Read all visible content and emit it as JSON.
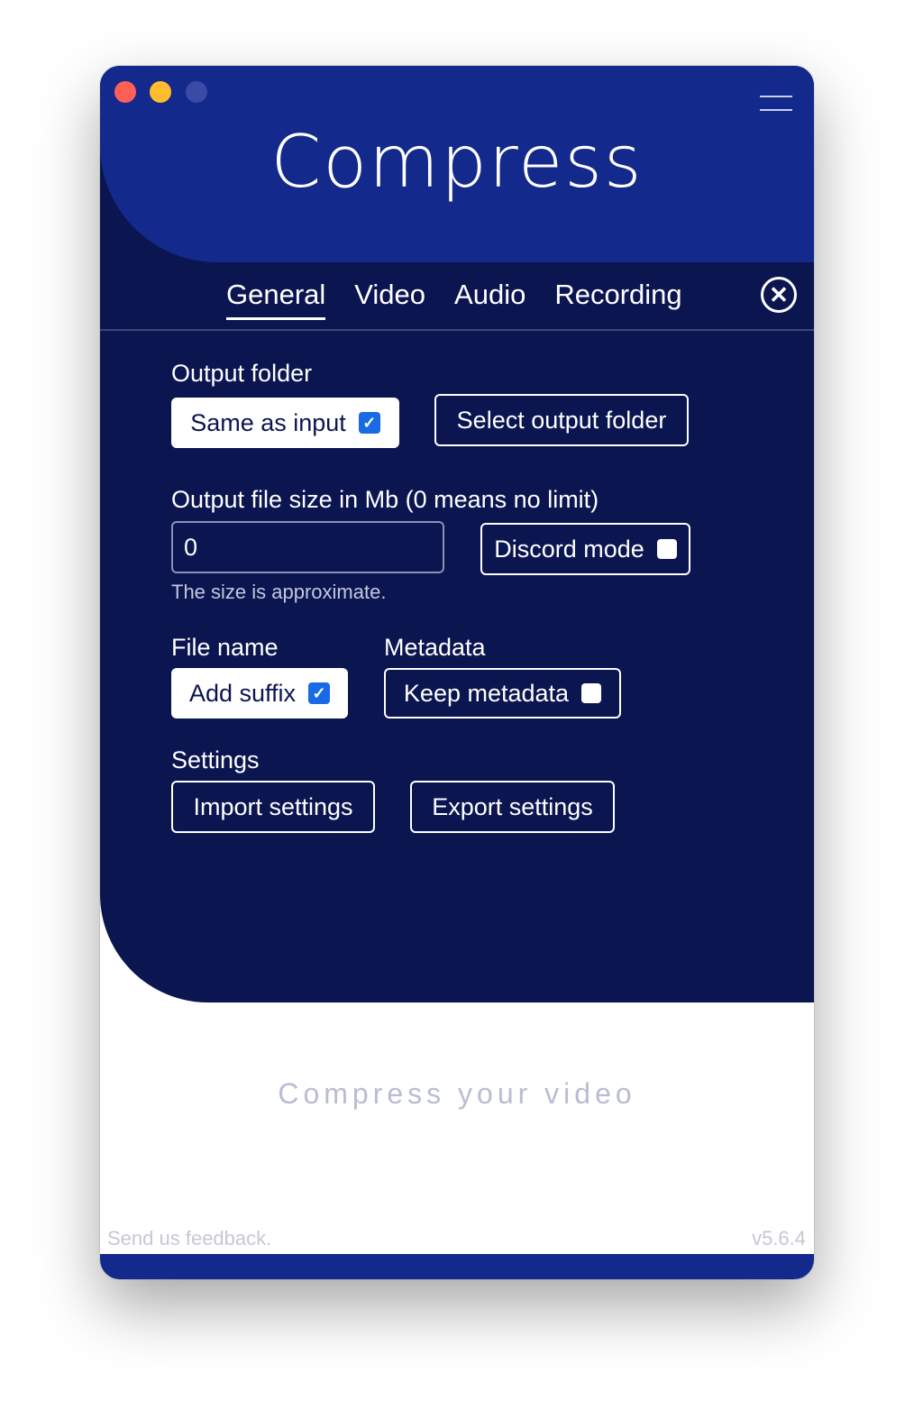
{
  "app": {
    "title": "Compress",
    "cta": "Compress your video",
    "feedback": "Send us feedback.",
    "version": "v5.6.4"
  },
  "colors": {
    "header": "#13298c",
    "panel": "#0b1550",
    "checkbox": "#1a6ae5"
  },
  "icons": {
    "menu": "hamburger-icon",
    "close": "close-circle-icon",
    "check": "checkmark-icon"
  },
  "tabs": [
    {
      "label": "General",
      "active": true
    },
    {
      "label": "Video",
      "active": false
    },
    {
      "label": "Audio",
      "active": false
    },
    {
      "label": "Recording",
      "active": false
    }
  ],
  "general": {
    "output_folder": {
      "label": "Output folder",
      "same_as_input_label": "Same as input",
      "same_as_input_checked": true,
      "select_button": "Select output folder"
    },
    "file_size": {
      "label": "Output file size in Mb (0 means no limit)",
      "value": "0",
      "hint": "The size is approximate.",
      "discord_label": "Discord mode",
      "discord_checked": false
    },
    "file_name": {
      "label": "File name",
      "add_suffix_label": "Add suffix",
      "add_suffix_checked": true
    },
    "metadata": {
      "label": "Metadata",
      "keep_label": "Keep metadata",
      "keep_checked": false
    },
    "settings": {
      "label": "Settings",
      "import_button": "Import settings",
      "export_button": "Export settings"
    }
  }
}
